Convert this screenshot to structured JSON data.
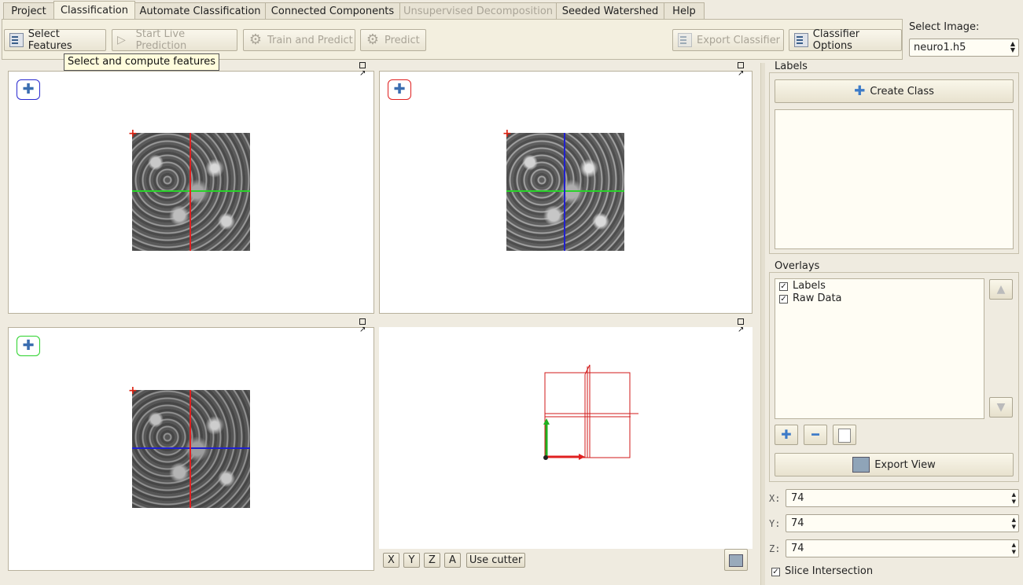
{
  "tabs": [
    {
      "label": "Project"
    },
    {
      "label": "Classification"
    },
    {
      "label": "Automate Classification"
    },
    {
      "label": "Connected Components"
    },
    {
      "label": "Unsupervised Decomposition"
    },
    {
      "label": "Seeded Watershed"
    },
    {
      "label": "Help"
    }
  ],
  "toolbar": {
    "select_features": "Select Features",
    "start_live_prediction": "Start Live Prediction",
    "train_and_predict": "Train and Predict",
    "predict": "Predict",
    "export_classifier": "Export Classifier",
    "classifier_options": "Classifier Options",
    "tooltip": "Select and compute features"
  },
  "image_select": {
    "label": "Select Image:",
    "value": "neuro1.h5"
  },
  "views": {
    "buttons": [
      "X",
      "Y",
      "Z",
      "A"
    ],
    "use_cutter": "Use cutter"
  },
  "labels_panel": {
    "title": "Labels",
    "create_class": "Create Class"
  },
  "overlays_panel": {
    "title": "Overlays",
    "items": [
      {
        "label": "Labels",
        "checked": true
      },
      {
        "label": "Raw Data",
        "checked": true
      }
    ],
    "export_view": "Export View"
  },
  "coords": {
    "x_label": "X:",
    "x": "74",
    "y_label": "Y:",
    "y": "74",
    "z_label": "Z:",
    "z": "74"
  },
  "slice_intersection": {
    "label": "Slice Intersection",
    "checked": true
  },
  "colors": {
    "x_axis": "#e02020",
    "y_axis": "#20c020",
    "z_axis": "#2020d0"
  }
}
